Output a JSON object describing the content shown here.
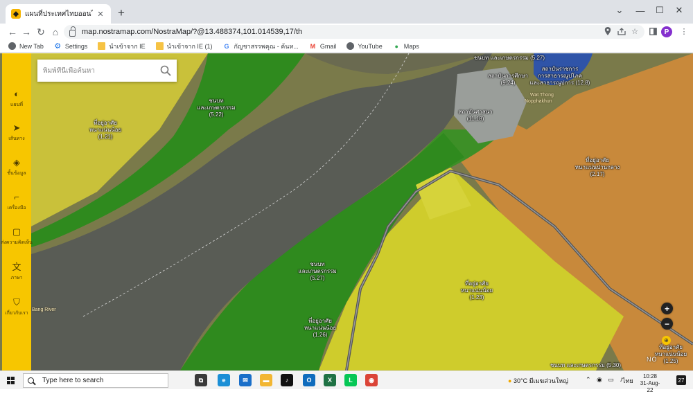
{
  "browser": {
    "tab": {
      "title": "แผนที่ประเทศไทยออนไลน์ แผนที่ประเทศ",
      "favicon_icon": "nostra-pin-icon"
    },
    "new_tab_symbol": "+",
    "window_controls": {
      "collapse": "⌄",
      "minimize": "—",
      "maximize": "☐",
      "close": "✕"
    },
    "nav": {
      "back": "←",
      "forward": "→",
      "reload": "↻",
      "home": "⌂"
    },
    "url": "map.nostramap.com/NostraMap/?@13.488374,101.014539,17/th",
    "profile_initial": "P",
    "bookmarks": [
      {
        "label": "New Tab",
        "icon": "globe-icon"
      },
      {
        "label": "Settings",
        "icon": "gear-icon"
      },
      {
        "label": "นำเข้าจาก IE",
        "icon": "folder-icon"
      },
      {
        "label": "นำเข้าจาก IE (1)",
        "icon": "folder-icon"
      },
      {
        "label": "กัญชาสรรพคุณ - ค้นห...",
        "icon": "google-icon"
      },
      {
        "label": "Gmail",
        "icon": "gmail-icon"
      },
      {
        "label": "YouTube",
        "icon": "globe-icon"
      },
      {
        "label": "Maps",
        "icon": "maps-pin-icon"
      }
    ]
  },
  "map": {
    "search": {
      "placeholder": "พิมพ์ที่นี่เพื่อค้นหา"
    },
    "sidebar": [
      {
        "label": "แผนที่",
        "icon": "map-layers-icon"
      },
      {
        "label": "เส้นทาง",
        "icon": "navigation-arrow-icon"
      },
      {
        "label": "ชั้นข้อมูล",
        "icon": "stack-layers-icon"
      },
      {
        "label": "เครื่องมือ",
        "icon": "ruler-tool-icon"
      },
      {
        "label": "ส่งความคิดเห็น",
        "icon": "feedback-icon"
      },
      {
        "label": "ภาษา",
        "icon": "language-icon"
      },
      {
        "label": "เกี่ยวกับเรา",
        "icon": "shield-info-icon"
      }
    ],
    "zones": [
      {
        "line1": "ชนบท",
        "line2": "และเกษตรกรรม",
        "code": "(5.22)"
      },
      {
        "line1": "ที่อยู่อาศัย",
        "line2": "หนาแน่นน้อย",
        "code": "(1.21)"
      },
      {
        "line1": "สถาบันการศึกษา",
        "line2": "",
        "code": "(9.24)"
      },
      {
        "line1": "สถาบันศาสนา",
        "line2": "",
        "code": "(11.18)"
      },
      {
        "line1": "ที่อยู่อาศัย",
        "line2": "หนาแน่นปานกลาง",
        "code": "(2.17)"
      },
      {
        "line1": "ชนบท",
        "line2": "และเกษตรกรรม",
        "code": "(5.27)"
      },
      {
        "line1": "ที่อยู่อาศัย",
        "line2": "หนาแน่นน้อย",
        "code": "(1.23)"
      },
      {
        "line1": "ที่อยู่อาศัย",
        "line2": "หนาแน่นน้อย",
        "code": "(1.26)"
      },
      {
        "line1": "ชนบท และเกษตรกรรม",
        "line2": "",
        "code": "(5.30)"
      },
      {
        "line1": "ที่อยู่อาศัย",
        "line2": "หนาแน่นน้อย",
        "code": "(1.25)"
      },
      {
        "line1": "สถาบันราชการ",
        "line2": "การสาธารณูปโภค",
        "code": "และสาธารณูปการ (12.8)"
      },
      {
        "line1": "ชนบท และเกษตรกรรม",
        "line2": "",
        "code": "(5.27)"
      }
    ],
    "places": [
      {
        "text": "Wat Thong"
      },
      {
        "text": "Nopphakhun"
      },
      {
        "text": "Bang River"
      }
    ],
    "zoom_in": "+",
    "zoom_out": "−",
    "brand_text": "NO"
  },
  "taskbar": {
    "search_placeholder": "Type here to search",
    "apps": [
      {
        "name": "task-view-icon",
        "color": "#3a3a3a",
        "glyph": "⧉"
      },
      {
        "name": "edge-icon",
        "color": "#1b8fd6",
        "glyph": "e"
      },
      {
        "name": "mail-icon",
        "color": "#1a6fc9",
        "glyph": "✉"
      },
      {
        "name": "file-explorer-icon",
        "color": "#f2b632",
        "glyph": "▬"
      },
      {
        "name": "tiktok-icon",
        "color": "#111111",
        "glyph": "♪"
      },
      {
        "name": "outlook-icon",
        "color": "#0f6cbd",
        "glyph": "O"
      },
      {
        "name": "excel-icon",
        "color": "#1f7244",
        "glyph": "X"
      },
      {
        "name": "line-icon",
        "color": "#06c755",
        "glyph": "L"
      },
      {
        "name": "chrome-icon",
        "color": "#db4437",
        "glyph": "◉"
      }
    ],
    "weather": {
      "temp": "30°C",
      "desc": "มีเมฆส่วนใหญ่"
    },
    "lang": "ไทย",
    "time": "10:28",
    "date": "31-Aug-22",
    "notifications": "27"
  }
}
